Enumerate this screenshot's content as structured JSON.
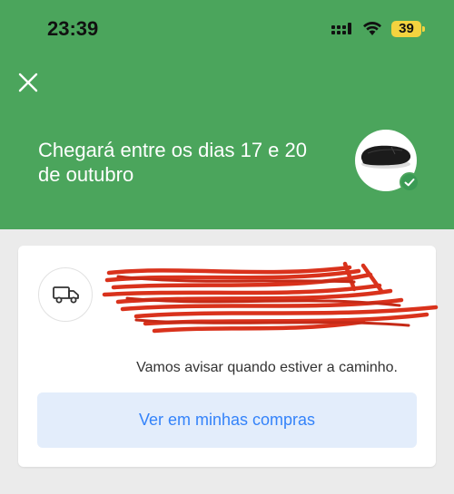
{
  "status_bar": {
    "time": "23:39",
    "battery": "39",
    "battery_color": "#f3d33f"
  },
  "header": {
    "background": "#4ba55c",
    "headline": "Chegará entre os dias 17 e 20 de outubro",
    "close_icon": "close-icon",
    "product_image": "wireless-mouse",
    "status_icon": "check-icon"
  },
  "card": {
    "shipment_icon": "truck-icon",
    "notice": "Vamos avisar quando estiver a caminho.",
    "cta_label": "Ver em minhas compras",
    "cta_background": "#e3edfb",
    "cta_text_color": "#3483fa"
  }
}
